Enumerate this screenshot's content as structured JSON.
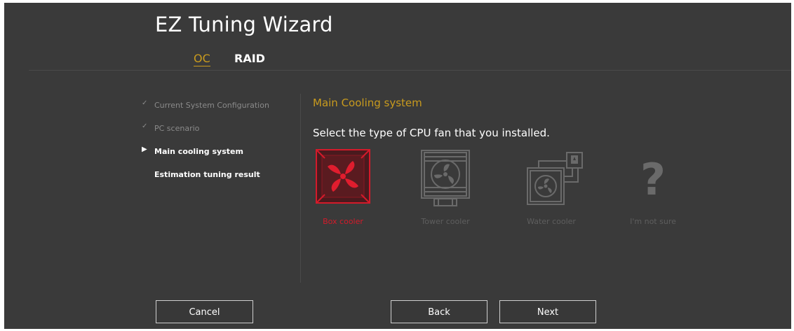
{
  "window": {
    "title": "EZ Tuning Wizard"
  },
  "tabs": [
    {
      "label": "OC",
      "active": true
    },
    {
      "label": "RAID",
      "active": false
    }
  ],
  "steps": [
    {
      "label": "Current System Configuration",
      "state": "done",
      "marker": "✓"
    },
    {
      "label": "PC scenario",
      "state": "done",
      "marker": "✓"
    },
    {
      "label": "Main cooling system",
      "state": "current",
      "marker": "▶"
    },
    {
      "label": "Estimation tuning result",
      "state": "pending",
      "marker": ""
    }
  ],
  "content": {
    "section_title": "Main Cooling system",
    "question": "Select the type of CPU fan that you installed."
  },
  "options": [
    {
      "label": "Box cooler",
      "icon": "box-cooler-icon",
      "selected": true
    },
    {
      "label": "Tower cooler",
      "icon": "tower-cooler-icon",
      "selected": false
    },
    {
      "label": "Water cooler",
      "icon": "water-cooler-icon",
      "selected": false
    },
    {
      "label": "I'm not sure",
      "icon": "question-mark-icon",
      "selected": false
    }
  ],
  "buttons": {
    "cancel": "Cancel",
    "back": "Back",
    "next": "Next"
  },
  "colors": {
    "background": "#3a3a3a",
    "accent": "#c99b1e",
    "selected": "#d41a2a",
    "disabled_icon": "#5e5e5e"
  }
}
